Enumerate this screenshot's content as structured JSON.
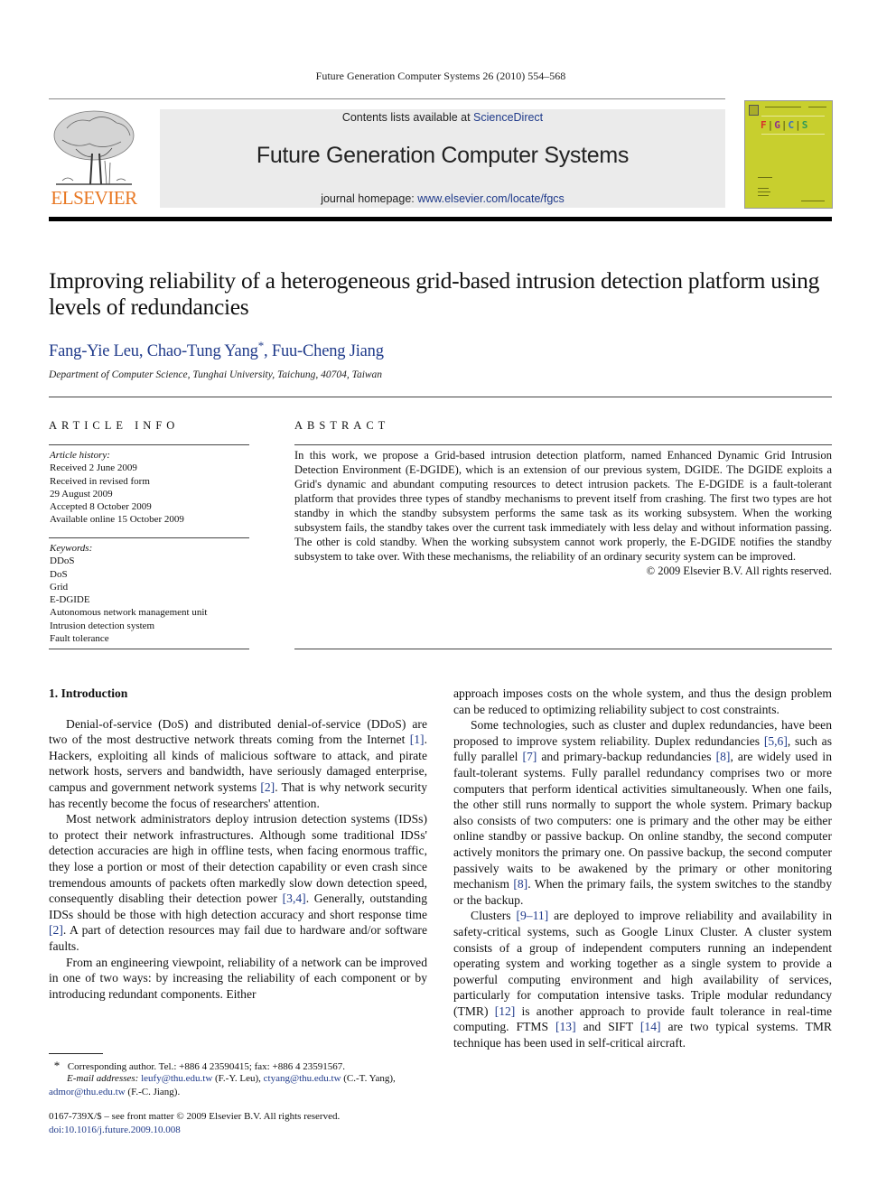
{
  "header": {
    "running_head": "Future Generation Computer Systems 26 (2010) 554–568",
    "publisher_logo_text": "ELSEVIER",
    "contents_prefix": "Contents lists available at ",
    "contents_link": "ScienceDirect",
    "journal_title": "Future Generation Computer Systems",
    "homepage_prefix": "journal homepage: ",
    "homepage_link": "www.elsevier.com/locate/fgcs",
    "cover_letters": [
      "F",
      "G",
      "C",
      "S"
    ],
    "colors": {
      "elsevier_orange": "#e87722",
      "link_blue": "#1f3a8a",
      "banner_gray": "#ebebeb",
      "cover_yellow": "#c8cf2e"
    }
  },
  "article": {
    "title": "Improving reliability of a heterogeneous grid-based intrusion detection platform using levels of redundancies",
    "authors": [
      {
        "name": "Fang-Yie Leu",
        "sep": ", "
      },
      {
        "name": "Chao-Tung Yang",
        "mark": "*",
        "sep": ", "
      },
      {
        "name": "Fuu-Cheng Jiang",
        "sep": ""
      }
    ],
    "affiliation": "Department of Computer Science, Tunghai University, Taichung, 40704, Taiwan"
  },
  "article_info": {
    "heading": "ARTICLE INFO",
    "history_label": "Article history:",
    "history": [
      "Received 2 June 2009",
      "Received in revised form",
      "29 August 2009",
      "Accepted 8 October 2009",
      "Available online 15 October 2009"
    ],
    "keywords_label": "Keywords:",
    "keywords": [
      "DDoS",
      "DoS",
      "Grid",
      "E-DGIDE",
      "Autonomous network management unit",
      "Intrusion detection system",
      "Fault tolerance"
    ]
  },
  "abstract": {
    "heading": "ABSTRACT",
    "text": "In this work, we propose a Grid-based intrusion detection platform, named Enhanced Dynamic Grid Intrusion Detection Environment (E-DGIDE), which is an extension of our previous system, DGIDE. The DGIDE exploits a Grid's dynamic and abundant computing resources to detect intrusion packets. The E-DGIDE is a fault-tolerant platform that provides three types of standby mechanisms to prevent itself from crashing. The first two types are hot standby in which the standby subsystem performs the same task as its working subsystem. When the working subsystem fails, the standby takes over the current task immediately with less delay and without information passing. The other is cold standby. When the working subsystem cannot work properly, the E-DGIDE notifies the standby subsystem to take over. With these mechanisms, the reliability of an ordinary security system can be improved.",
    "copyright": "© 2009 Elsevier B.V. All rights reserved."
  },
  "body": {
    "section_title": "1. Introduction",
    "left_paragraphs": [
      [
        {
          "t": "Denial-of-service (DoS) and distributed denial-of-service (DDoS) are two of the most destructive network threats coming from the Internet "
        },
        {
          "t": "[1]",
          "ref": true
        },
        {
          "t": ". Hackers, exploiting all kinds of malicious software to attack, and pirate network hosts, servers and bandwidth, have seriously damaged enterprise, campus and government network systems "
        },
        {
          "t": "[2]",
          "ref": true
        },
        {
          "t": ". That is why network security has recently become the focus of researchers' attention."
        }
      ],
      [
        {
          "t": "Most network administrators deploy intrusion detection systems (IDSs) to protect their network infrastructures. Although some traditional IDSs' detection accuracies are high in offline tests, when facing enormous traffic, they lose a portion or most of their detection capability or even crash since tremendous amounts of packets often markedly slow down detection speed, consequently disabling their detection power "
        },
        {
          "t": "[3,4]",
          "ref": true
        },
        {
          "t": ". Generally, outstanding IDSs should be those with high detection accuracy and short response time "
        },
        {
          "t": "[2]",
          "ref": true
        },
        {
          "t": ". A part of detection resources may fail due to hardware and/or software faults."
        }
      ],
      [
        {
          "t": "From an engineering viewpoint, reliability of a network can be improved in one of two ways: by increasing the reliability of each component or by introducing redundant components. Either"
        }
      ]
    ],
    "right_paragraphs": [
      [
        {
          "t": "approach imposes costs on the whole system, and thus the design problem can be reduced to optimizing reliability subject to cost constraints."
        }
      ],
      [
        {
          "t": "Some technologies, such as cluster and duplex redundancies, have been proposed to improve system reliability. Duplex redundancies "
        },
        {
          "t": "[5,6]",
          "ref": true
        },
        {
          "t": ", such as fully parallel "
        },
        {
          "t": "[7]",
          "ref": true
        },
        {
          "t": " and primary-backup redundancies "
        },
        {
          "t": "[8]",
          "ref": true
        },
        {
          "t": ", are widely used in fault-tolerant systems. Fully parallel redundancy comprises two or more computers that perform identical activities simultaneously. When one fails, the other still runs normally to support the whole system. Primary backup also consists of two computers: one is primary and the other may be either online standby or passive backup. On online standby, the second computer actively monitors the primary one. On passive backup, the second computer passively waits to be awakened by the primary or other monitoring mechanism "
        },
        {
          "t": "[8]",
          "ref": true
        },
        {
          "t": ". When the primary fails, the system switches to the standby or the backup."
        }
      ],
      [
        {
          "t": "Clusters "
        },
        {
          "t": "[9–11]",
          "ref": true
        },
        {
          "t": " are deployed to improve reliability and availability in safety-critical systems, such as Google Linux Cluster. A cluster system consists of a group of independent computers running an independent operating system and working together as a single system to provide a powerful computing environment and high availability of services, particularly for computation intensive tasks. Triple modular redundancy (TMR) "
        },
        {
          "t": "[12]",
          "ref": true
        },
        {
          "t": " is another approach to provide fault tolerance in real-time computing. FTMS "
        },
        {
          "t": "[13]",
          "ref": true
        },
        {
          "t": " and SIFT "
        },
        {
          "t": "[14]",
          "ref": true
        },
        {
          "t": " are two typical systems. TMR technique has been used in self-critical aircraft."
        }
      ]
    ]
  },
  "footnotes": {
    "corresponding_mark": "*",
    "corresponding_text": "Corresponding author. Tel.: +886 4 23590415; fax: +886 4 23591567.",
    "email_label": "E-mail addresses:",
    "emails": [
      {
        "addr": "leufy@thu.edu.tw",
        "who": " (F.-Y. Leu), "
      },
      {
        "addr": "ctyang@thu.edu.tw",
        "who": " (C.-T. Yang), "
      },
      {
        "addr": "admor@thu.edu.tw",
        "who": " (F.-C. Jiang)."
      }
    ],
    "issn_line": "0167-739X/$ – see front matter © 2009 Elsevier B.V. All rights reserved.",
    "doi": "doi:10.1016/j.future.2009.10.008"
  }
}
